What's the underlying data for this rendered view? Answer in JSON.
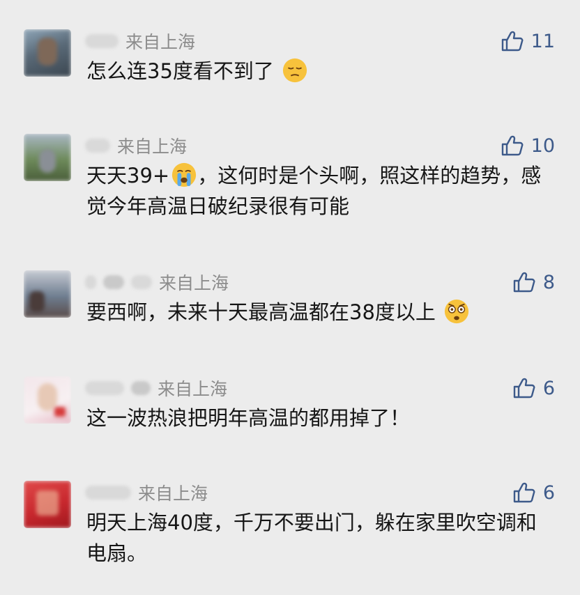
{
  "comments": [
    {
      "location": "来自上海",
      "likes": "11",
      "text": "怎么连35度看不到了",
      "emoji": "smirking-sleepy-face-icon",
      "avatar_colors": [
        "#5a6a78",
        "#3b4650",
        "#8fa6b8"
      ]
    },
    {
      "location": "来自上海",
      "likes": "10",
      "text": "天天39+",
      "emoji": "crying-face-icon",
      "text_after": "，这何时是个头啊，照这样的趋势，感觉今年高温日破纪录很有可能",
      "avatar_colors": [
        "#5f7a4a",
        "#a9b7c4",
        "#4a5e3a"
      ]
    },
    {
      "location": "来自上海",
      "likes": "8",
      "text": "要西啊，未来十天最高温都在38度以上",
      "emoji": "shocked-face-icon",
      "avatar_colors": [
        "#6e7d90",
        "#c7cbd3",
        "#5a4c4a"
      ]
    },
    {
      "location": "来自上海",
      "likes": "6",
      "text": "这一波热浪把明年高温的都用掉了！",
      "avatar_colors": [
        "#f3e6ea",
        "#e8b8c4",
        "#d63c3c"
      ]
    },
    {
      "location": "来自上海",
      "likes": "6",
      "text": "明天上海40度，千万不要出门，躲在家里吹空调和电扇。",
      "avatar_colors": [
        "#c8282e",
        "#e04a4a",
        "#a0181e"
      ]
    }
  ]
}
